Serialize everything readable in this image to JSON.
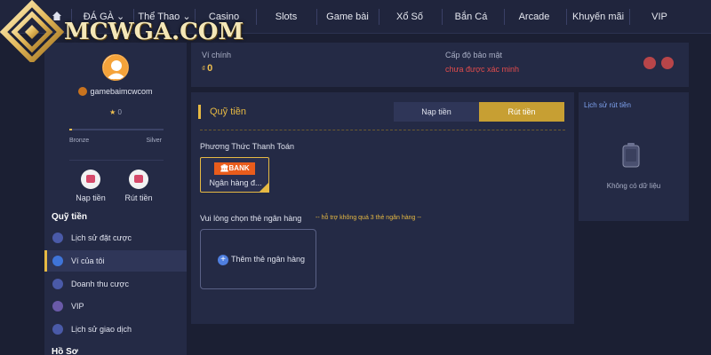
{
  "brand": {
    "logo_text": "MCWGA.COM"
  },
  "nav": [
    {
      "label": "ĐÁ GÀ",
      "dropdown": true
    },
    {
      "label": "Thể Thao",
      "dropdown": true
    },
    {
      "label": "Casino"
    },
    {
      "label": "Slots"
    },
    {
      "label": "Game bài"
    },
    {
      "label": "Xổ Số"
    },
    {
      "label": "Bắn Cá"
    },
    {
      "label": "Arcade"
    },
    {
      "label": "Khuyến mãi"
    },
    {
      "label": "VIP"
    }
  ],
  "profile": {
    "username": "gamebaimcwcom",
    "stars": "0",
    "rank_current": "Bronze",
    "rank_next": "Silver",
    "progress": 0.03
  },
  "quick_actions": {
    "deposit": "Nạp tiền",
    "withdraw": "Rút tiền"
  },
  "sidebar_menu": {
    "section_title": "Quỹ tiền",
    "items": [
      "Lịch sử đặt cược",
      "Ví của tôi",
      "Doanh thu cược",
      "VIP",
      "Lịch sử giao dịch"
    ],
    "active_index": 1,
    "section2_title": "Hồ Sơ"
  },
  "wallet": {
    "main_label": "Ví chính",
    "currency": "₫",
    "balance": "0",
    "security_label": "Cấp độ bảo mật",
    "security_value": "chưa được xác minh"
  },
  "funds": {
    "title": "Quỹ tiền",
    "tabs": [
      "Nạp tiền",
      "Rút tiền"
    ],
    "active_tab": "Rút tiền",
    "payment_label": "Phương Thức Thanh Toán",
    "bank_logo": "BANK",
    "bank_name": "Ngân hàng đ...",
    "choose_bank_label": "Vui lòng chọn thẻ ngân hàng",
    "choose_bank_hint": "-- hỗ trợ không quá 3 thẻ ngân hàng --",
    "add_card_label": "Thêm thẻ ngân hàng"
  },
  "history": {
    "title": "Lịch sử rút tiền",
    "empty": "Không có dữ liệu"
  },
  "colors": {
    "accent": "#e6b943",
    "danger": "#e24c4c",
    "link": "#7fa3f0"
  }
}
